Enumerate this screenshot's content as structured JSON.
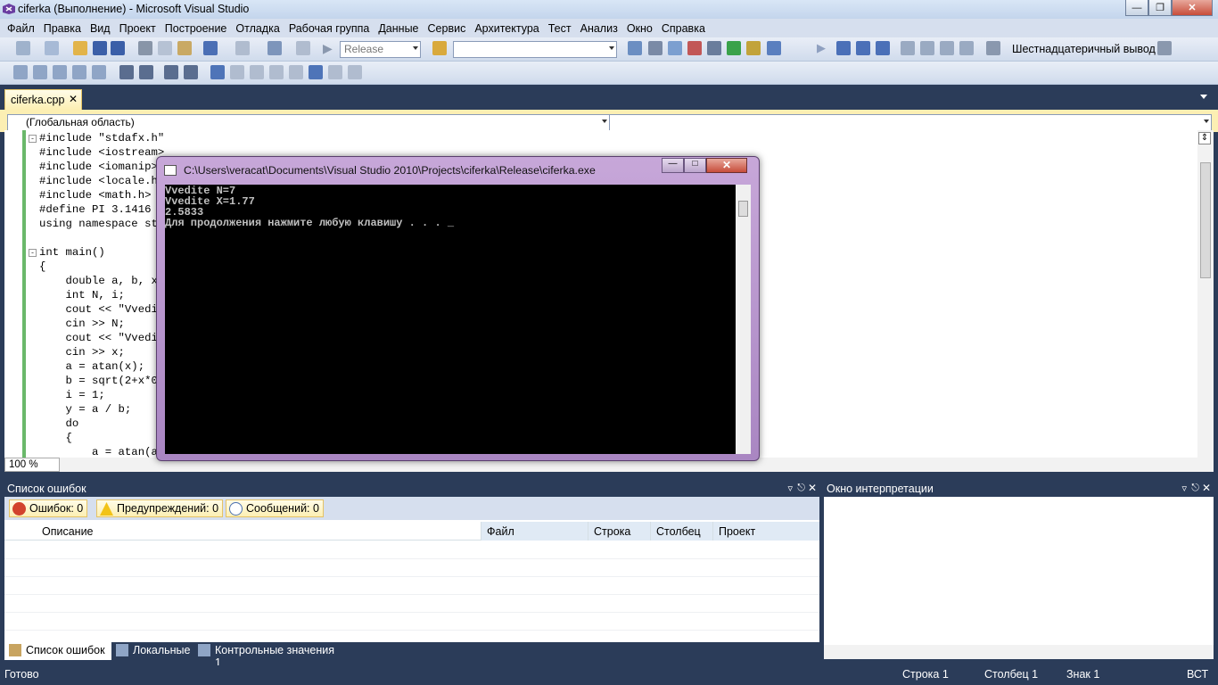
{
  "window": {
    "title": "ciferka (Выполнение) - Microsoft Visual Studio"
  },
  "menu": [
    "Файл",
    "Правка",
    "Вид",
    "Проект",
    "Построение",
    "Отладка",
    "Рабочая группа",
    "Данные",
    "Сервис",
    "Архитектура",
    "Тест",
    "Анализ",
    "Окно",
    "Справка"
  ],
  "toolbar": {
    "config_value": "Release",
    "find_value": "",
    "hex_label": "Шестнадцатеричный вывод"
  },
  "tab": {
    "file_name": "ciferka.cpp",
    "close": "✕"
  },
  "navbar": {
    "scope": "(Глобальная область)",
    "member": ""
  },
  "code_lines": [
    "#include \"stdafx.h\"",
    "#include <iostream>",
    "#include <iomanip>",
    "#include <locale.h>",
    "#include <math.h>",
    "#define PI 3.1416",
    "using namespace std;",
    "",
    "int main()",
    "{",
    "    double a, b, x,",
    "    int N, i;",
    "    cout << \"Vvedit",
    "    cin >> N;",
    "    cout << \"Vvedit",
    "    cin >> x;",
    "    a = atan(x);",
    "    b = sqrt(2+x*0)",
    "    i = 1;",
    "    y = a / b;",
    "    do",
    "    {",
    "        a = atan(a)"
  ],
  "zoom": "100 %",
  "console": {
    "title": "C:\\Users\\veracat\\Documents\\Visual Studio 2010\\Projects\\ciferka\\Release\\ciferka.exe",
    "lines": [
      "Vvedite N=7",
      "Vvedite X=1.77",
      "2.5833",
      "Для продолжения нажмите любую клавишу . . . _"
    ]
  },
  "error_list": {
    "title": "Список ошибок",
    "errors": "Ошибок: 0",
    "warnings": "Предупреждений: 0",
    "messages": "Сообщений: 0",
    "columns": [
      "Описание",
      "Файл",
      "Строка",
      "Столбец",
      "Проект"
    ]
  },
  "immediate": {
    "title": "Окно интерпретации"
  },
  "bottom_tabs": [
    "Список ошибок",
    "Локальные",
    "Контрольные значения 1"
  ],
  "status": {
    "ready": "Готово",
    "line": "Строка 1",
    "col": "Столбец 1",
    "char": "Знак 1",
    "mode": "ВСТ"
  },
  "colors": {
    "chrome_dark": "#2b3c59",
    "tab_active": "#fcefb3",
    "console_frame": "#b896cc"
  }
}
